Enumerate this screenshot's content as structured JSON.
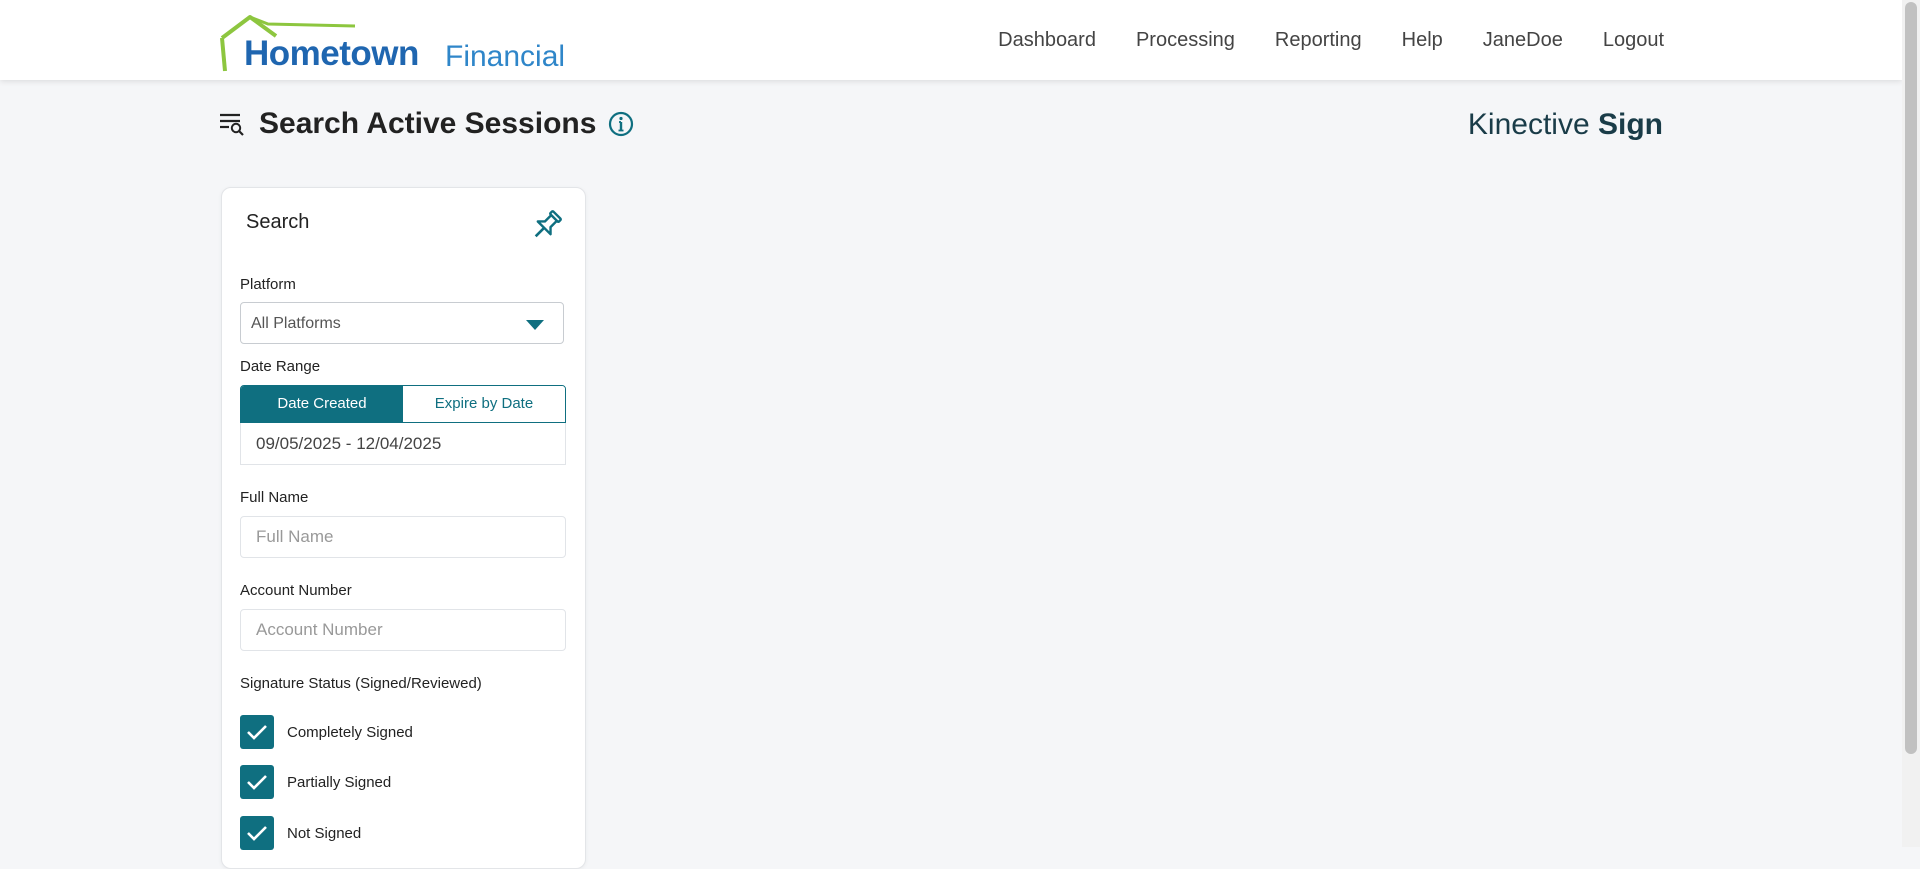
{
  "logo": {
    "word1": "Hometown",
    "word2": "Financial"
  },
  "nav": {
    "dashboard": "Dashboard",
    "processing": "Processing",
    "reporting": "Reporting",
    "help": "Help",
    "user": "JaneDoe",
    "logout": "Logout"
  },
  "header": {
    "title": "Search Active Sessions"
  },
  "brand": {
    "part1": "Kinective ",
    "part2": "Sign"
  },
  "search_panel": {
    "title": "Search",
    "platform_label": "Platform",
    "platform_value": "All Platforms",
    "date_range_label": "Date Range",
    "date_created_tab": "Date Created",
    "expire_by_date_tab": "Expire by Date",
    "date_range_value": "09/05/2025 - 12/04/2025",
    "full_name_label": "Full Name",
    "full_name_placeholder": "Full Name",
    "account_number_label": "Account Number",
    "account_number_placeholder": "Account Number",
    "signature_status_label": "Signature Status (Signed/Reviewed)",
    "status_options": [
      "Completely Signed",
      "Partially Signed",
      "Not Signed"
    ]
  },
  "colors": {
    "accent": "#0f6f80",
    "logo_blue": "#1f66b0",
    "logo_green": "#8dc63f"
  },
  "icons": {
    "header": "search-filter-icon",
    "info": "info-icon",
    "pin": "pin-icon",
    "caret": "caret-down-icon",
    "check": "checkmark-icon"
  }
}
